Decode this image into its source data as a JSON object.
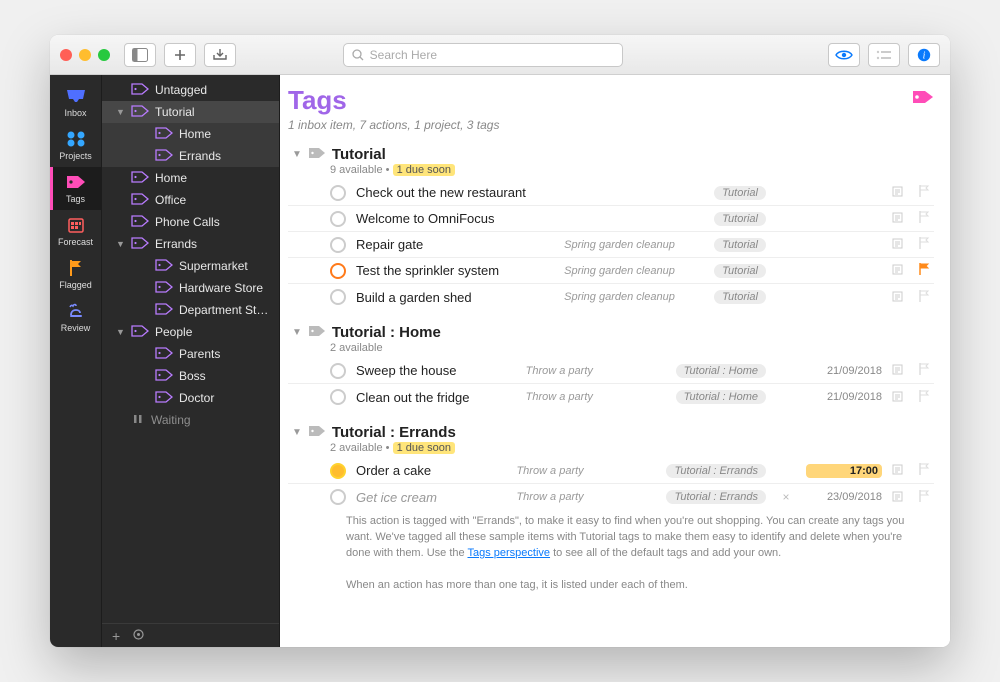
{
  "toolbar": {
    "search_placeholder": "Search Here"
  },
  "rail": [
    {
      "id": "inbox",
      "label": "Inbox",
      "color": "#5a7cff"
    },
    {
      "id": "projects",
      "label": "Projects",
      "color": "#34a7ff"
    },
    {
      "id": "tags",
      "label": "Tags",
      "color": "#ff4db8",
      "active": true
    },
    {
      "id": "forecast",
      "label": "Forecast",
      "color": "#ff5e5e"
    },
    {
      "id": "flagged",
      "label": "Flagged",
      "color": "#ff9a1a"
    },
    {
      "id": "review",
      "label": "Review",
      "color": "#7a8bff"
    }
  ],
  "sidebar": {
    "items": [
      {
        "label": "Untagged",
        "depth": 0
      },
      {
        "label": "Tutorial",
        "depth": 0,
        "open": true,
        "selected": true
      },
      {
        "label": "Home",
        "depth": 1,
        "selected": "partial"
      },
      {
        "label": "Errands",
        "depth": 1,
        "selected": "partial"
      },
      {
        "label": "Home",
        "depth": 0
      },
      {
        "label": "Office",
        "depth": 0
      },
      {
        "label": "Phone Calls",
        "depth": 0
      },
      {
        "label": "Errands",
        "depth": 0,
        "open": true
      },
      {
        "label": "Supermarket",
        "depth": 1
      },
      {
        "label": "Hardware Store",
        "depth": 1
      },
      {
        "label": "Department Store",
        "depth": 1
      },
      {
        "label": "People",
        "depth": 0,
        "open": true
      },
      {
        "label": "Parents",
        "depth": 1
      },
      {
        "label": "Boss",
        "depth": 1
      },
      {
        "label": "Doctor",
        "depth": 1
      },
      {
        "label": "Waiting",
        "depth": 0,
        "paused": true
      }
    ]
  },
  "main": {
    "title": "Tags",
    "subtitle": "1 inbox item, 7 actions, 1 project, 3 tags",
    "groups": [
      {
        "title": "Tutorial",
        "sub_count": "9 available",
        "sub_warn": "1 due soon",
        "tasks": [
          {
            "title": "Check out the new restaurant",
            "proj": "",
            "tag": "Tutorial"
          },
          {
            "title": "Welcome to OmniFocus",
            "proj": "",
            "tag": "Tutorial"
          },
          {
            "title": "Repair gate",
            "proj": "Spring garden cleanup",
            "tag": "Tutorial"
          },
          {
            "title": "Test the sprinkler system",
            "proj": "Spring garden cleanup",
            "tag": "Tutorial",
            "circle": "orange",
            "flag": true
          },
          {
            "title": "Build a garden shed",
            "proj": "Spring garden cleanup",
            "tag": "Tutorial"
          }
        ]
      },
      {
        "title": "Tutorial : Home",
        "sub_count": "2 available",
        "tasks": [
          {
            "title": "Sweep the house",
            "proj": "Throw a party",
            "tag": "Tutorial : Home",
            "date": "21/09/2018"
          },
          {
            "title": "Clean out the fridge",
            "proj": "Throw a party",
            "tag": "Tutorial : Home",
            "date": "21/09/2018"
          }
        ]
      },
      {
        "title": "Tutorial : Errands",
        "sub_count": "2 available",
        "sub_warn": "1 due soon",
        "tasks": [
          {
            "title": "Order a cake",
            "proj": "Throw a party",
            "tag": "Tutorial : Errands",
            "date": "17:00",
            "date_hot": true,
            "circle": "yellow"
          },
          {
            "title": "Get ice cream",
            "proj": "Throw a party",
            "tag": "Tutorial : Errands",
            "date": "23/09/2018",
            "muted": true,
            "extra": true
          }
        ],
        "description": {
          "p1": "This action is tagged with \"Errands\", to make it easy to find when you're out shopping. You can create any tags you want. We've tagged all these sample items with Tutorial tags to make them easy to identify and delete when you're done with them. Use the ",
          "link": "Tags perspective",
          "p1b": " to see all of the default tags and add your own.",
          "p2": "When an action has more than one tag, it is listed under each of them."
        }
      }
    ]
  }
}
